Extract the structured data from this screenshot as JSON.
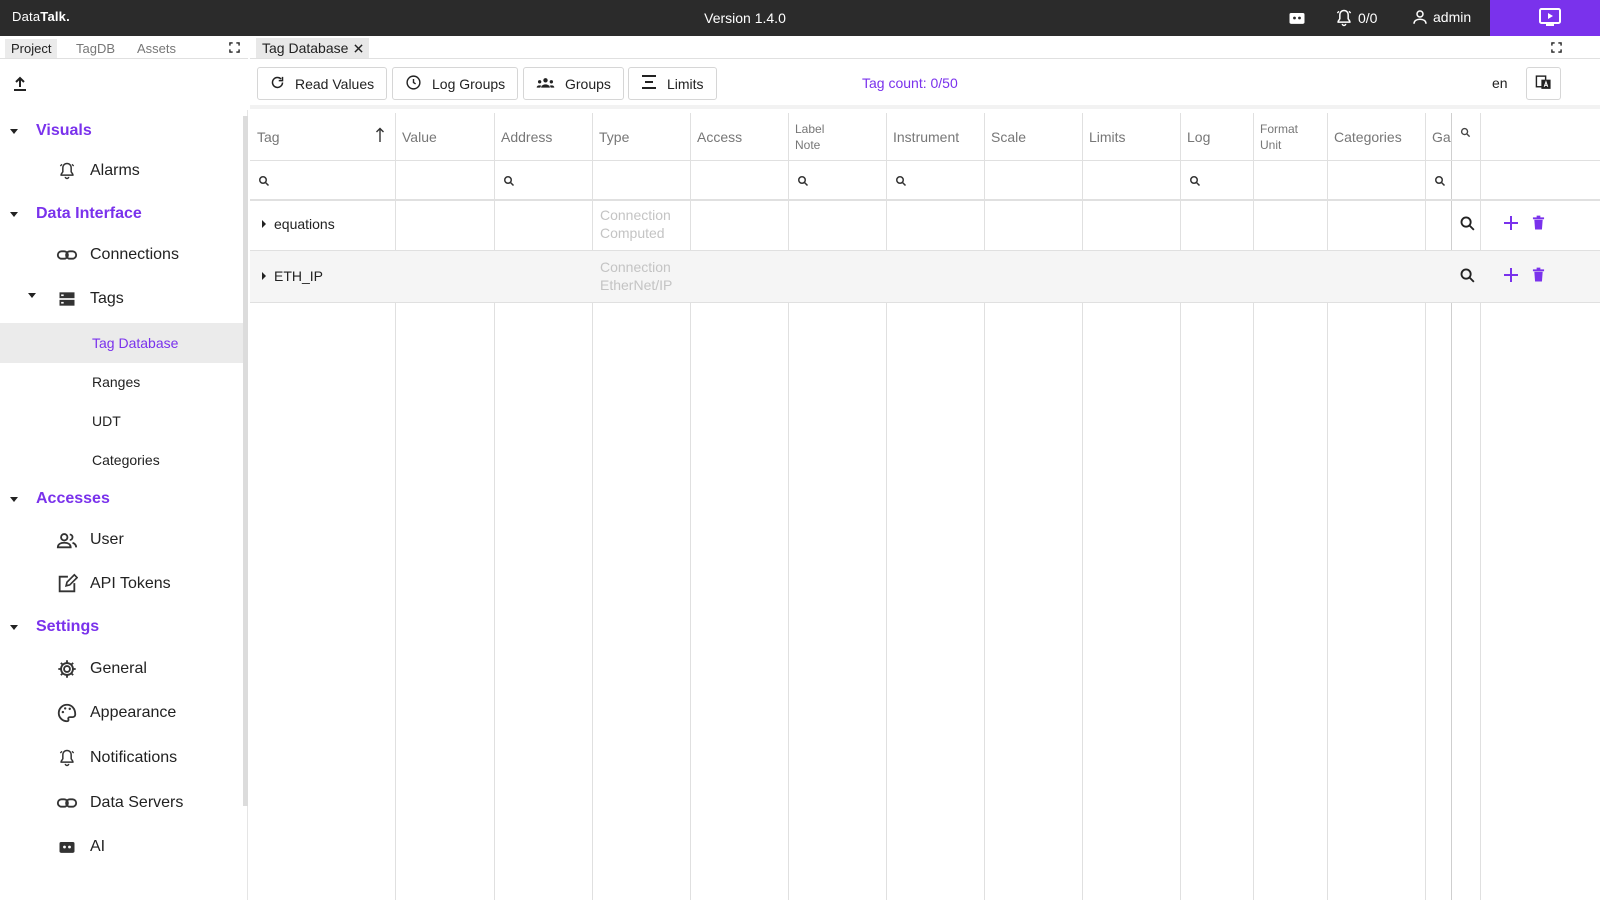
{
  "header": {
    "logo_plain": "Data",
    "logo_bold": "Talk.",
    "version": "Version 1.4.0",
    "alarm_count": "0/0",
    "user": "admin",
    "accent": "#7a32ec",
    "bar_bg": "#2b2b2b"
  },
  "sidebar": {
    "tabs": [
      "Project",
      "TagDB",
      "Assets"
    ],
    "sections": {
      "visuals": {
        "title": "Visuals",
        "items": [
          "Alarms"
        ]
      },
      "data_interface": {
        "title": "Data Interface",
        "connections": "Connections",
        "tags": "Tags",
        "tag_sub": [
          "Tag Database",
          "Ranges",
          "UDT",
          "Categories"
        ]
      },
      "accesses": {
        "title": "Accesses",
        "items": [
          "User",
          "API Tokens"
        ]
      },
      "settings": {
        "title": "Settings",
        "items": [
          "General",
          "Appearance",
          "Notifications",
          "Data Servers",
          "AI"
        ]
      }
    }
  },
  "doc_tab": {
    "label": "Tag Database"
  },
  "toolbar": {
    "read_values": "Read Values",
    "log_groups": "Log Groups",
    "groups": "Groups",
    "limits": "Limits",
    "tag_count": "Tag count: 0/50",
    "language": "en"
  },
  "table": {
    "columns": [
      "Tag",
      "Value",
      "Address",
      "Type",
      "Access",
      "Label\nNote",
      "Instrument",
      "Scale",
      "Limits",
      "Log",
      "Format\nUnit",
      "Categories",
      "Ga"
    ],
    "col_label_note": [
      "Label",
      "Note"
    ],
    "col_format_unit": [
      "Format",
      "Unit"
    ],
    "rows": [
      {
        "name": "equations",
        "type_line1": "Connection",
        "type_line2": "Computed"
      },
      {
        "name": "ETH_IP",
        "type_line1": "Connection",
        "type_line2": "EtherNet/IP"
      }
    ]
  }
}
